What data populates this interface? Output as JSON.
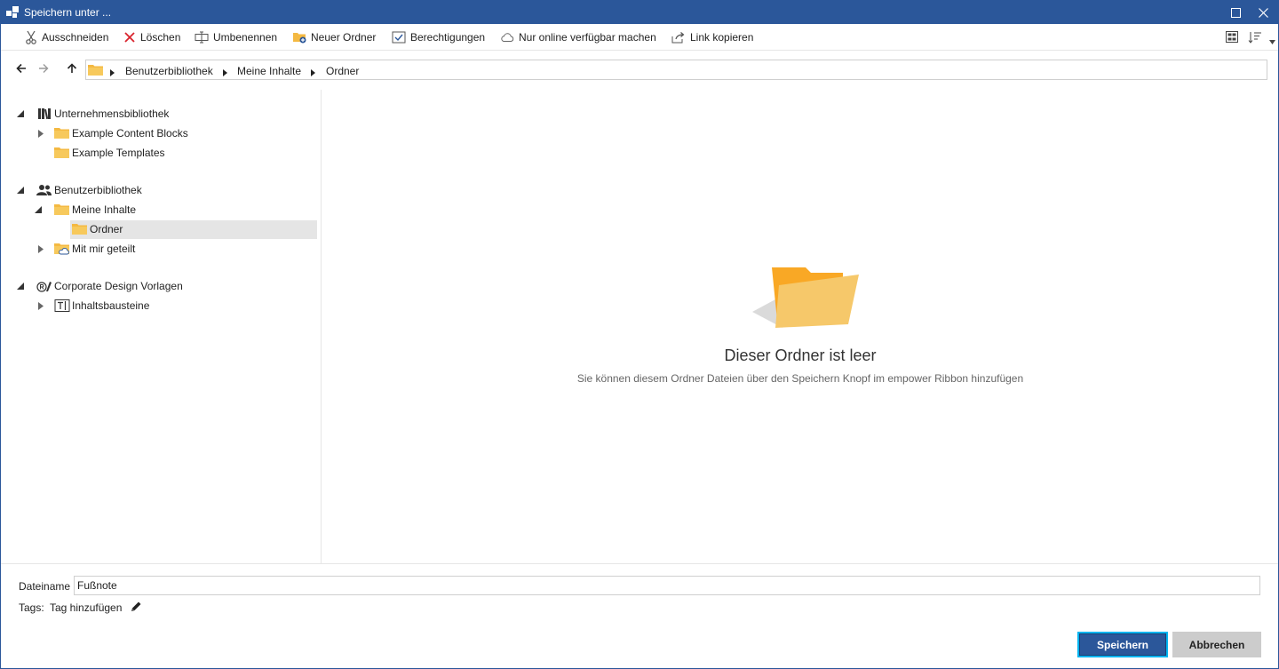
{
  "window": {
    "title": "Speichern unter ...",
    "accent": "#2b579a"
  },
  "toolbar": {
    "items": [
      {
        "label": "Ausschneiden",
        "icon": "scissors-icon"
      },
      {
        "label": "Löschen",
        "icon": "delete-x-icon"
      },
      {
        "label": "Umbenennen",
        "icon": "rename-icon"
      },
      {
        "label": "Neuer Ordner",
        "icon": "new-folder-icon"
      },
      {
        "label": "Berechtigungen",
        "icon": "permissions-icon"
      },
      {
        "label": "Nur online verfügbar machen",
        "icon": "cloud-icon"
      },
      {
        "label": "Link kopieren",
        "icon": "share-link-icon"
      }
    ],
    "right_icons": [
      "view-tiles-icon",
      "sort-icon",
      "dropdown-arrow-icon"
    ]
  },
  "breadcrumb": {
    "items": [
      "Benutzerbibliothek",
      "Meine Inhalte",
      "Ordner"
    ]
  },
  "tree": {
    "items": [
      {
        "label": "Unternehmensbibliothek",
        "icon": "library-books-icon",
        "expanded": true
      },
      {
        "label": "Example Content Blocks",
        "icon": "folder-icon",
        "expanded": false
      },
      {
        "label": "Example Templates",
        "icon": "folder-icon"
      },
      {
        "label": "Benutzerbibliothek",
        "icon": "users-icon",
        "expanded": true
      },
      {
        "label": "Meine Inhalte",
        "icon": "folder-icon",
        "expanded": true
      },
      {
        "label": "Ordner",
        "icon": "folder-icon",
        "selected": true
      },
      {
        "label": "Mit mir geteilt",
        "icon": "shared-folder-icon",
        "expanded": false
      },
      {
        "label": "Corporate Design Vorlagen",
        "icon": "corporate-design-icon",
        "expanded": true
      },
      {
        "label": "Inhaltsbausteine",
        "icon": "text-block-icon",
        "expanded": false
      }
    ]
  },
  "empty_state": {
    "title": "Dieser Ordner ist leer",
    "subtitle": "Sie können diesem Ordner Dateien über den Speichern Knopf im empower Ribbon hinzufügen"
  },
  "form": {
    "filename_label": "Dateiname",
    "filename_value": "Fußnote",
    "tags_label": "Tags:",
    "tags_link": "Tag hinzufügen"
  },
  "buttons": {
    "save": "Speichern",
    "cancel": "Abbrechen"
  }
}
